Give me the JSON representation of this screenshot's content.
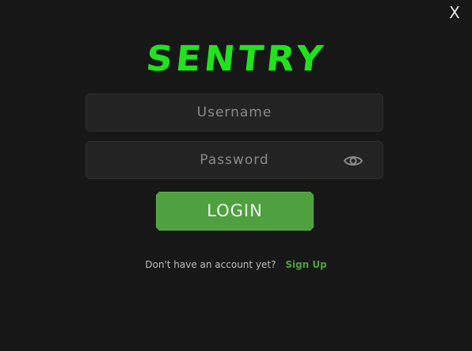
{
  "window": {
    "close_label": "X"
  },
  "logo": {
    "text": "SENTRY"
  },
  "form": {
    "username_placeholder": "Username",
    "password_placeholder": "Password",
    "password_toggle_icon": "eye-icon",
    "login_label": "LOGIN"
  },
  "signup": {
    "prompt": "Don't have an account yet?",
    "link": "Sign Up"
  },
  "colors": {
    "background": "#171717",
    "brand_green": "#22e21e",
    "button_green": "#4fa03f",
    "field_background": "#232323"
  }
}
